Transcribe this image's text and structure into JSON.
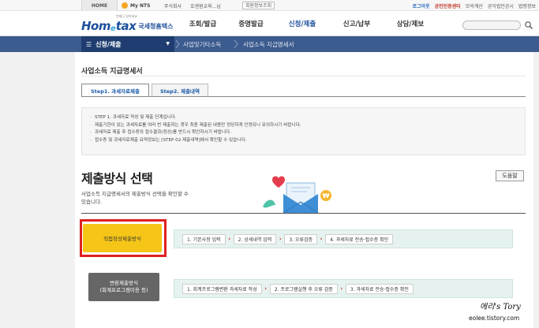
{
  "topbar": {
    "home": "HOME",
    "mynts": "My NTS",
    "company": "주식회사",
    "user": "호센원교육...님",
    "member_info": "회원정보조회",
    "links": [
      "로그아웃",
      "공인인증센터",
      "모의계산",
      "공익법인공시",
      "법령정보"
    ]
  },
  "header": {
    "logo_tagline": "언제나 일하세요",
    "logo_main": "Hom",
    "logo_e": "e",
    "logo_tax": "tax",
    "logo_kor": "국세청홈택스",
    "menus": [
      "조회/발급",
      "증명발급",
      "신청/제출",
      "신고/납부",
      "상담/제보"
    ],
    "active_menu": "신청/제출",
    "search_placeholder": ""
  },
  "subnav": {
    "first": "신청/제출",
    "crumbs": [
      "사업및기타소득",
      "사업소득 지급명세서"
    ]
  },
  "page": {
    "title": "사업소득 지급명세서",
    "tabs": [
      "Step1. 과세자료제출",
      "Step2. 제출내역"
    ],
    "notice": [
      "STEP 1. 과세자료 작성 및 제출 단계입니다.",
      "제출기한이 있는 과세자료를 여러 번 제출하는 경우 최종 제출된 내용만 정당하게 인정되니 유의하시기 바랍니다.",
      "과세자료 제출 후 접수증의 접수결과(정상)를 반드시 확인하시기 바랍니다.",
      "접수증 및 과세자료제출 요약정보는 [STEP 02.제출내역]에서 확인할 수 있습니다."
    ],
    "section_title": "제출방식 선택",
    "help_label": "도움말",
    "description": "사업소득 지급명세서의 제출방식 선택을 확인할 수 있습니다.",
    "direct_button": "직접작성제출방식",
    "direct_steps": [
      "1. 기본사항 입력",
      "2. 상세내역 입력",
      "3. 오류검증",
      "4. 과세자료 전송·접수증 확인"
    ],
    "convert_button_line1": "변환제출방식",
    "convert_button_line2": "(회계프로그램이용 등)",
    "convert_steps": [
      "1. 회계프로그램변환 과세자료 작성",
      "2. 프로그램실행 후 오류 검증",
      "3. 과세자료 전송·접수증 확인"
    ]
  },
  "watermark": {
    "line1": "에리's Tory",
    "line2": "eolee.tistory.com"
  },
  "colors": {
    "brand": "#1c4f9c",
    "subnav": "#3c5b8e",
    "highlight": "#e02020",
    "direct_button": "#f5c518"
  }
}
